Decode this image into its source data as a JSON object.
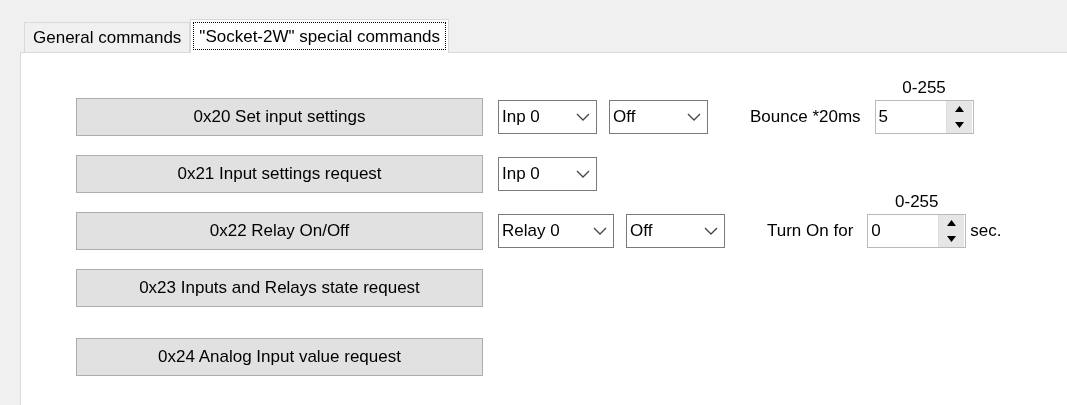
{
  "tabs": [
    {
      "label": "General commands",
      "selected": false
    },
    {
      "label": "\"Socket-2W\" special commands",
      "selected": true
    }
  ],
  "rows": [
    {
      "button": "0x20 Set input settings",
      "controls": [
        {
          "kind": "combo",
          "value": "Inp 0"
        },
        {
          "kind": "combo",
          "value": "Off"
        },
        {
          "kind": "label",
          "text": "Bounce *20ms"
        },
        {
          "kind": "spin",
          "value": "5",
          "range": "0-255"
        }
      ]
    },
    {
      "button": "0x21 Input settings request",
      "controls": [
        {
          "kind": "combo",
          "value": "Inp 0"
        }
      ]
    },
    {
      "button": "0x22 Relay On/Off",
      "controls": [
        {
          "kind": "combo",
          "value": "Relay 0"
        },
        {
          "kind": "combo",
          "value": "Off"
        },
        {
          "kind": "label",
          "text": "Turn On for"
        },
        {
          "kind": "spin",
          "value": "0",
          "range": "0-255"
        },
        {
          "kind": "suffix",
          "text": "sec."
        }
      ]
    },
    {
      "button": "0x23 Inputs and Relays state request",
      "controls": []
    },
    {
      "button": "0x24 Analog Input value request",
      "controls": []
    }
  ]
}
